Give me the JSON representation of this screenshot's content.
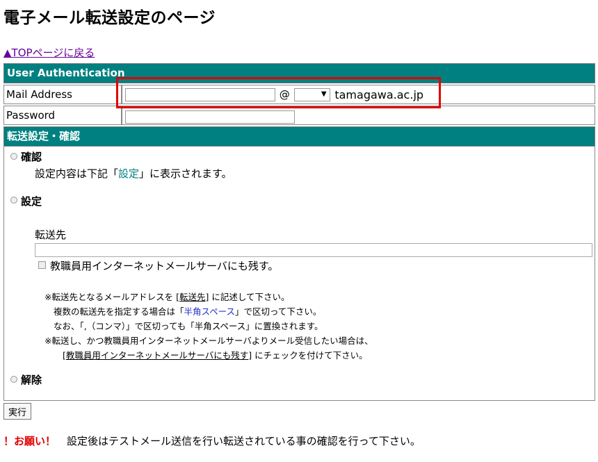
{
  "page": {
    "title": "電子メール転送設定のページ",
    "top_link": "▲TOPページに戻る"
  },
  "auth": {
    "header": "User Authentication",
    "mail_label": "Mail Address",
    "at": "@",
    "mail_user_value": "",
    "domain_selected": "",
    "domain_suffix": "tamagawa.ac.jp",
    "password_label": "Password",
    "password_value": ""
  },
  "forwarding": {
    "header": "転送設定・確認",
    "confirm": {
      "label": "確認",
      "desc_before": "設定内容は下記「",
      "desc_link": "設定",
      "desc_after": "」に表示されます。"
    },
    "setting": {
      "label": "設定",
      "destination_label": "転送先",
      "destination_value": "",
      "keep_copy_label": "教職員用インターネットメールサーバにも残す。"
    },
    "notes": {
      "line1_a": "※転送先となるメールアドレスを [",
      "line1_link": "転送先",
      "line1_b": "] に記述して下さい。",
      "line2_a": "複数の転送先を指定する場合は「",
      "line2_blue": "半角スペース",
      "line2_b": "」で区切って下さい。",
      "line3": "なお、「,（コンマ）」で区切っても「半角スペース」に置換されます。",
      "line4": "※転送し、かつ教職員用インターネットメールサーバよりメール受信したい場合は、",
      "line5_a": "[",
      "line5_link": "教職員用インターネットメールサーバにも残す",
      "line5_b": "] にチェックを付けて下さい。"
    },
    "cancel": {
      "label": "解除"
    }
  },
  "actions": {
    "run": "実行"
  },
  "footer": {
    "request": "！お願い！",
    "text": "設定後はテストメール送信を行い転送されている事の確認を行って下さい。"
  }
}
